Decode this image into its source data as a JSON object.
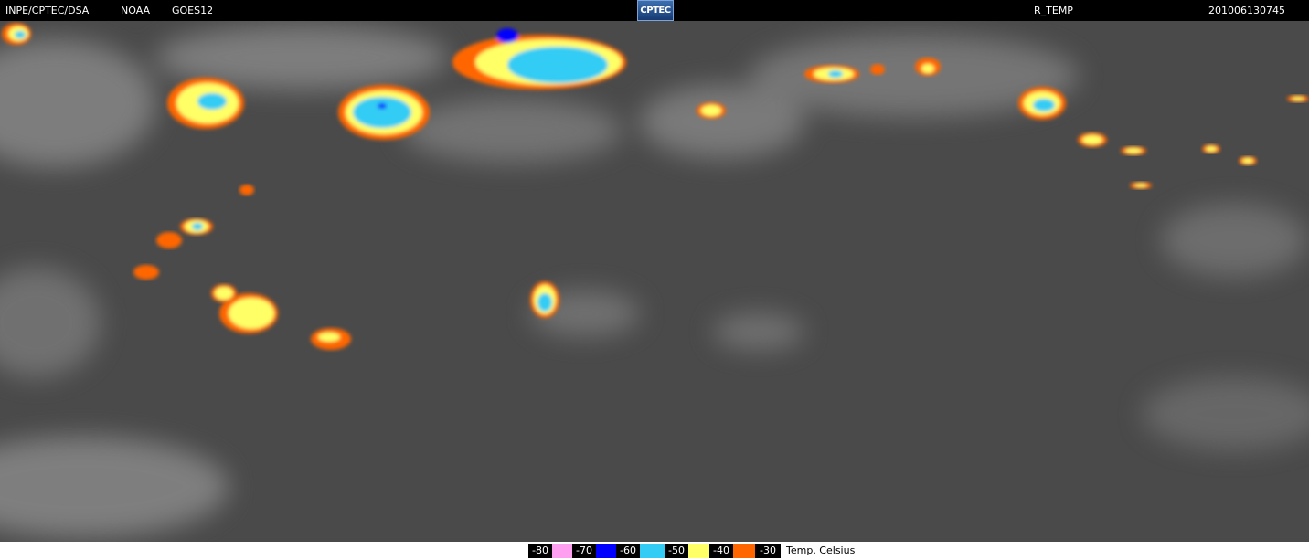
{
  "header": {
    "agency": "INPE/CPTEC/DSA",
    "source": "NOAA",
    "satellite": "GOES12",
    "logo_text": "CPTEC",
    "product": "R_TEMP",
    "timestamp": "201006130745"
  },
  "legend": {
    "unit": "Temp. Celsius",
    "bins": [
      {
        "label": "-80",
        "color": "#ff9ff0"
      },
      {
        "label": "-70",
        "color": "#0000ff"
      },
      {
        "label": "-60",
        "color": "#33ccf4"
      },
      {
        "label": "-50",
        "color": "#ffff66"
      },
      {
        "label": "-40",
        "color": "#ff6600"
      },
      {
        "label": "-30",
        "color": ""
      }
    ]
  },
  "colors": {
    "background_gray": "#4a4a4a",
    "cloud_gray": "#bdbdbd",
    "ring_orange": "#ff6600",
    "ring_yellow": "#ffff66",
    "ring_cyan": "#33ccf4",
    "ring_blue": "#0000ff"
  }
}
